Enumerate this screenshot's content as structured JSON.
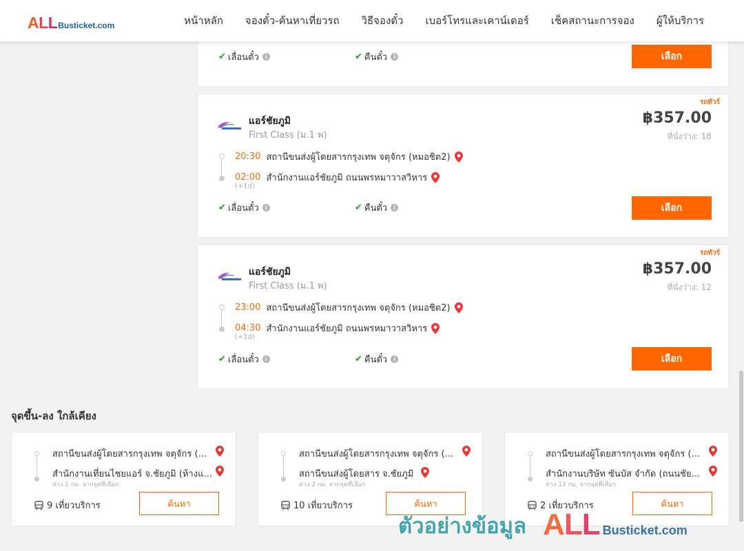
{
  "header": {
    "logo_all": "ALL",
    "logo_rest": "Busticket.com",
    "nav": [
      {
        "label": "หน้าหลัก"
      },
      {
        "label": "จองตั๋ว-ค้นหาเที่ยวรถ"
      },
      {
        "label": "วิธีจองตั๋ว"
      },
      {
        "label": "เบอร์โทรและเคาน์เตอร์"
      },
      {
        "label": "เช็คสถานะการจอง"
      },
      {
        "label": "ผู้ให้บริการ"
      }
    ]
  },
  "card_top": {
    "feature_postpone": "เลื่อนตั๋ว",
    "feature_refund": "คืนตั๋ว",
    "select_label": "เลือก"
  },
  "trips": [
    {
      "promo": "รถทัวร์",
      "operator": "แอร์ชัยภูมิ",
      "bus_class": "First Class (ม.1 พ)",
      "price": "฿357.00",
      "seats": "ที่นั่งว่าง: 18",
      "dep_time": "20:30",
      "dep_station": "สถานีขนส่งผู้โดยสารกรุงเทพ จตุจักร (หมอชิต2)",
      "arr_time": "02:00",
      "arr_station": "สำนักงานแอร์ชัยภูมิ ถนนพรหมาวาสวิหาร",
      "next_day": "(+1d)",
      "feature_postpone": "เลื่อนตั๋ว",
      "feature_refund": "คืนตั๋ว",
      "select_label": "เลือก"
    },
    {
      "promo": "รถทัวร์",
      "operator": "แอร์ชัยภูมิ",
      "bus_class": "First Class (ม.1 พ)",
      "price": "฿357.00",
      "seats": "ที่นั่งว่าง: 12",
      "dep_time": "23:00",
      "dep_station": "สถานีขนส่งผู้โดยสารกรุงเทพ จตุจักร (หมอชิต2)",
      "arr_time": "04:30",
      "arr_station": "สำนักงานแอร์ชัยภูมิ ถนนพรหมาวาสวิหาร",
      "next_day": "(+1d)",
      "feature_postpone": "เลื่อนตั๋ว",
      "feature_refund": "คืนตั๋ว",
      "select_label": "เลือก"
    }
  ],
  "nearby": {
    "title": "จุดขึ้น-ลง ใกล้เคียง",
    "cards": [
      {
        "from": "สถานีขนส่งผู้โดยสารกรุงเทพ จตุจักร (...",
        "to": "สำนักงานเที่ยนไชยแอร์ จ.ชัยภูมิ (ห้างแ...",
        "distance": "ห่าง 1 กม. จากจุดที่เลือก",
        "trips": "9 เที่ยวบริการ",
        "search_label": "ค้นหา"
      },
      {
        "from": "สถานีขนส่งผู้โดยสารกรุงเทพ จตุจักร (...",
        "to": "สถานีขนส่งผู้โดยสาร จ.ชัยภูมิ",
        "distance": "ห่าง 2 กม. จากจุดที่เลือก",
        "trips": "10 เที่ยวบริการ",
        "search_label": "ค้นหา"
      },
      {
        "from": "สถานีขนส่งผู้โดยสารกรุงเทพ จตุจักร (...",
        "to": "สำนักงานบริษัท ซันบัส จำกัด (ถนนชัย...",
        "distance": "ห่าง 13 กม. จากจุดที่เลือก",
        "trips": "2 เที่ยวบริการ",
        "search_label": "ค้นหา"
      }
    ]
  },
  "watermark": {
    "thai": "ตัวอย่างข้อมูล",
    "all": "ALL",
    "rest": "Busticket.com"
  },
  "colors": {
    "accent_orange": "#ff6600",
    "time_orange": "#f26a0b",
    "check_green": "#22a022",
    "pin_red": "#e53935",
    "brand_blue": "#1f5fa0"
  }
}
